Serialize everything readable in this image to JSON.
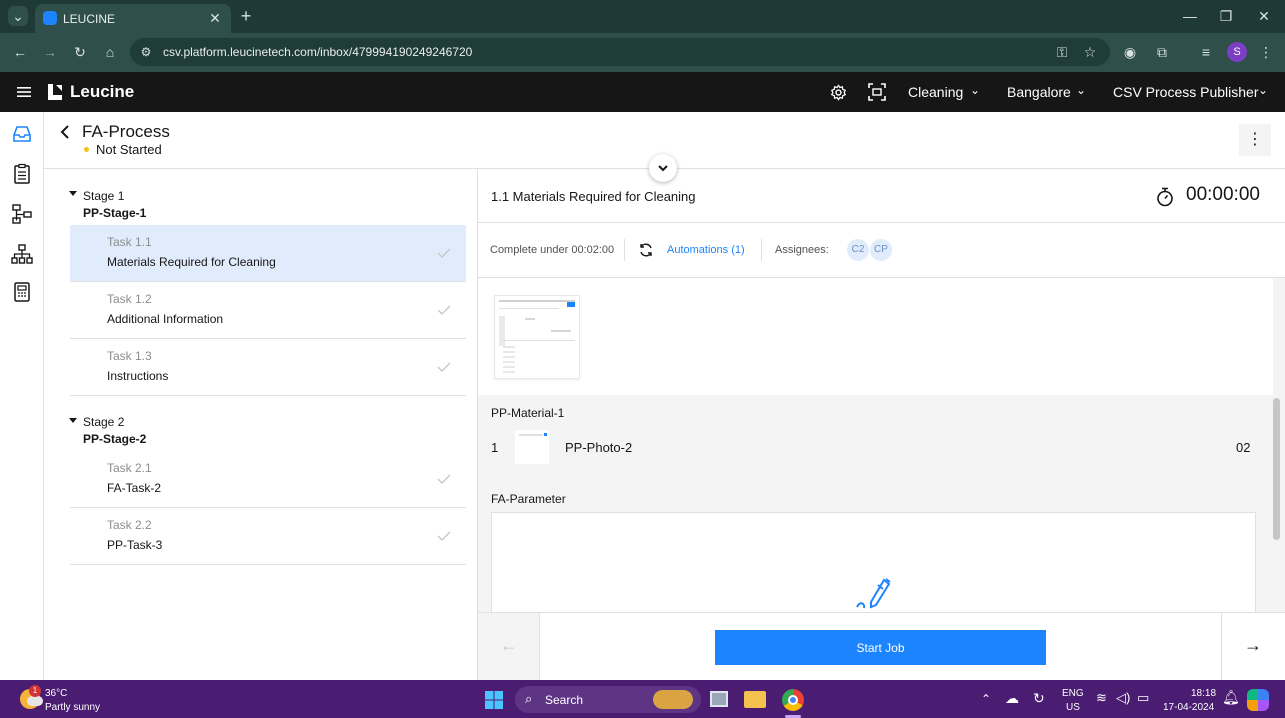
{
  "browser": {
    "tab_title": "LEUCINE",
    "url": "csv.platform.leucinetech.com/inbox/479994190249246720",
    "profile_initial": "S"
  },
  "app": {
    "brand": "Leucine",
    "header": {
      "facility": "Cleaning",
      "site": "Bangalore",
      "role": "CSV Process Publisher"
    }
  },
  "job": {
    "title": "FA-Process",
    "status": "Not Started",
    "status_color": "#f1c21b"
  },
  "stages": [
    {
      "label": "Stage 1",
      "name": "PP-Stage-1",
      "tasks": [
        {
          "number": "Task 1.1",
          "name": "Materials Required for Cleaning"
        },
        {
          "number": "Task 1.2",
          "name": "Additional Information"
        },
        {
          "number": "Task 1.3",
          "name": "Instructions"
        }
      ]
    },
    {
      "label": "Stage 2",
      "name": "PP-Stage-2",
      "tasks": [
        {
          "number": "Task 2.1",
          "name": "FA-Task-2"
        },
        {
          "number": "Task 2.2",
          "name": "PP-Task-3"
        }
      ]
    }
  ],
  "task_panel": {
    "title": "1.1 Materials Required for Cleaning",
    "timer": "00:00:00",
    "complete_under": "Complete under 00:02:00",
    "automations": "Automations (1)",
    "assignees_label": "Assignees:",
    "assignees": [
      "C2",
      "CP"
    ],
    "material_section": "PP-Material-1",
    "material_row": {
      "index": "1",
      "name": "PP-Photo-2",
      "qty": "02"
    },
    "parameter_section": "FA-Parameter",
    "start_button": "Start Job"
  },
  "colors": {
    "accent": "#1d84ff",
    "active_row": "#e0ecfb"
  },
  "taskbar": {
    "weather_temp": "36°C",
    "weather_desc": "Partly sunny",
    "weather_badge": "1",
    "search_placeholder": "Search",
    "lang_top": "ENG",
    "lang_bottom": "US",
    "time": "18:18",
    "date": "17-04-2024"
  }
}
